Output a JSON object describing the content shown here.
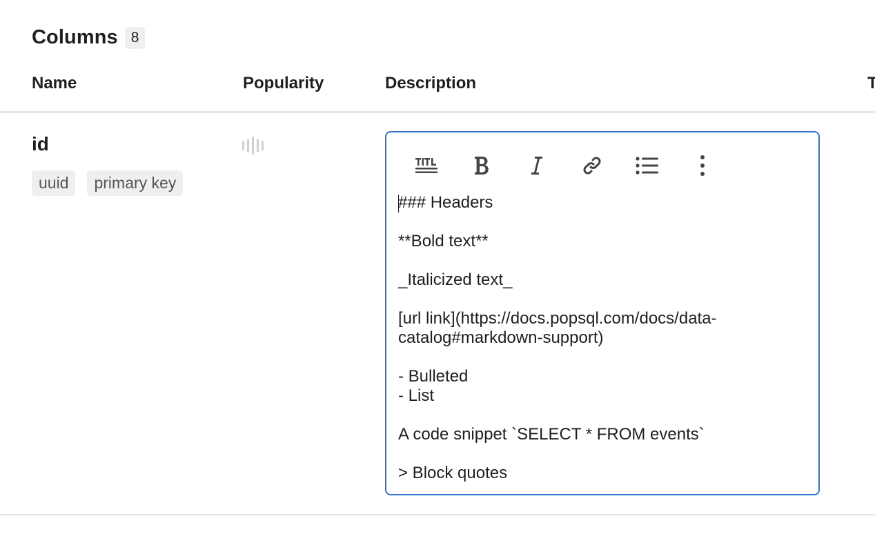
{
  "section": {
    "title": "Columns",
    "count": "8"
  },
  "table": {
    "headers": {
      "name": "Name",
      "popularity": "Popularity",
      "description": "Description",
      "type": "T"
    }
  },
  "row": {
    "name": "id",
    "tags": [
      "uuid",
      "primary key"
    ],
    "popularity_level": 0
  },
  "toolbar": {
    "buttons": [
      {
        "icon": "title-icon"
      },
      {
        "icon": "bold-icon"
      },
      {
        "icon": "italic-icon"
      },
      {
        "icon": "link-icon"
      },
      {
        "icon": "bulleted-list-icon"
      },
      {
        "icon": "more-options-icon"
      }
    ]
  },
  "editor": {
    "lines": [
      "### Headers",
      "",
      "**Bold text**",
      "",
      "_Italicized text_",
      "",
      "[url link](https://docs.popsql.com/docs/data-",
      "catalog#markdown-support)",
      "",
      "- Bulleted",
      "- List",
      "",
      "A code snippet `SELECT * FROM events`",
      "",
      "> Block quotes"
    ]
  },
  "colors": {
    "accent": "#2f74d0",
    "divider": "#e6e6e6",
    "tag_bg": "#efefef"
  }
}
